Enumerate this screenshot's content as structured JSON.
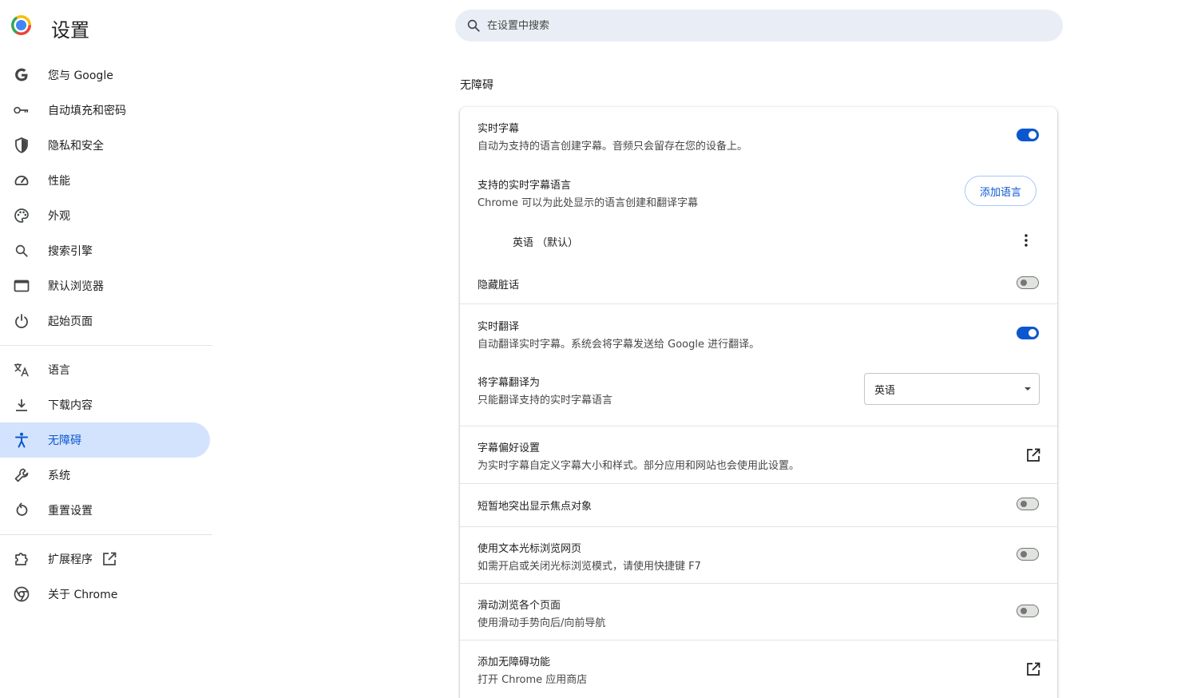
{
  "app": {
    "title": "设置"
  },
  "search": {
    "placeholder": "在设置中搜索"
  },
  "sidebar": {
    "items": [
      {
        "label": "您与 Google",
        "icon": "google-icon"
      },
      {
        "label": "自动填充和密码",
        "icon": "key-icon"
      },
      {
        "label": "隐私和安全",
        "icon": "shield-icon"
      },
      {
        "label": "性能",
        "icon": "speedometer-icon"
      },
      {
        "label": "外观",
        "icon": "palette-icon"
      },
      {
        "label": "搜索引擎",
        "icon": "search-icon"
      },
      {
        "label": "默认浏览器",
        "icon": "browser-window-icon"
      },
      {
        "label": "起始页面",
        "icon": "power-icon"
      },
      {
        "label": "语言",
        "icon": "translate-icon"
      },
      {
        "label": "下载内容",
        "icon": "download-icon"
      },
      {
        "label": "无障碍",
        "icon": "accessibility-icon",
        "active": true
      },
      {
        "label": "系统",
        "icon": "wrench-icon"
      },
      {
        "label": "重置设置",
        "icon": "reset-icon"
      },
      {
        "label": "扩展程序",
        "icon": "puzzle-icon"
      },
      {
        "label": "关于 Chrome",
        "icon": "chrome-icon"
      }
    ]
  },
  "section": {
    "title": "无障碍",
    "live_caption": {
      "title": "实时字幕",
      "subtitle": "自动为支持的语言创建字幕。音频只会留存在您的设备上。",
      "enabled": true
    },
    "caption_languages": {
      "title": "支持的实时字幕语言",
      "subtitle": "Chrome 可以为此处显示的语言创建和翻译字幕",
      "button": "添加语言",
      "language_item": "英语 （默认）"
    },
    "mask_profanity": {
      "title": "隐藏脏话",
      "enabled": false
    },
    "live_translate": {
      "title": "实时翻译",
      "subtitle": "自动翻译实时字幕。系统会将字幕发送给 Google 进行翻译。",
      "enabled": true
    },
    "translate_to": {
      "title": "将字幕翻译为",
      "subtitle": "只能翻译支持的实时字幕语言",
      "selected": "英语"
    },
    "caption_prefs": {
      "title": "字幕偏好设置",
      "subtitle": "为实时字幕自定义字幕大小和样式。部分应用和网站也会使用此设置。"
    },
    "focus_highlight": {
      "title": "短暂地突出显示焦点对象",
      "enabled": false
    },
    "caret_browsing": {
      "title": "使用文本光标浏览网页",
      "subtitle": "如需开启或关闭光标浏览模式，请使用快捷键 F7",
      "enabled": false
    },
    "swipe_navigation": {
      "title": "滑动浏览各个页面",
      "subtitle": "使用滑动手势向后/向前导航",
      "enabled": false
    },
    "add_features": {
      "title": "添加无障碍功能",
      "subtitle": "打开 Chrome 应用商店"
    }
  },
  "colors": {
    "accent": "#0b57d0",
    "active_bg": "#d3e3fd",
    "search_bg": "#e9eef6"
  }
}
